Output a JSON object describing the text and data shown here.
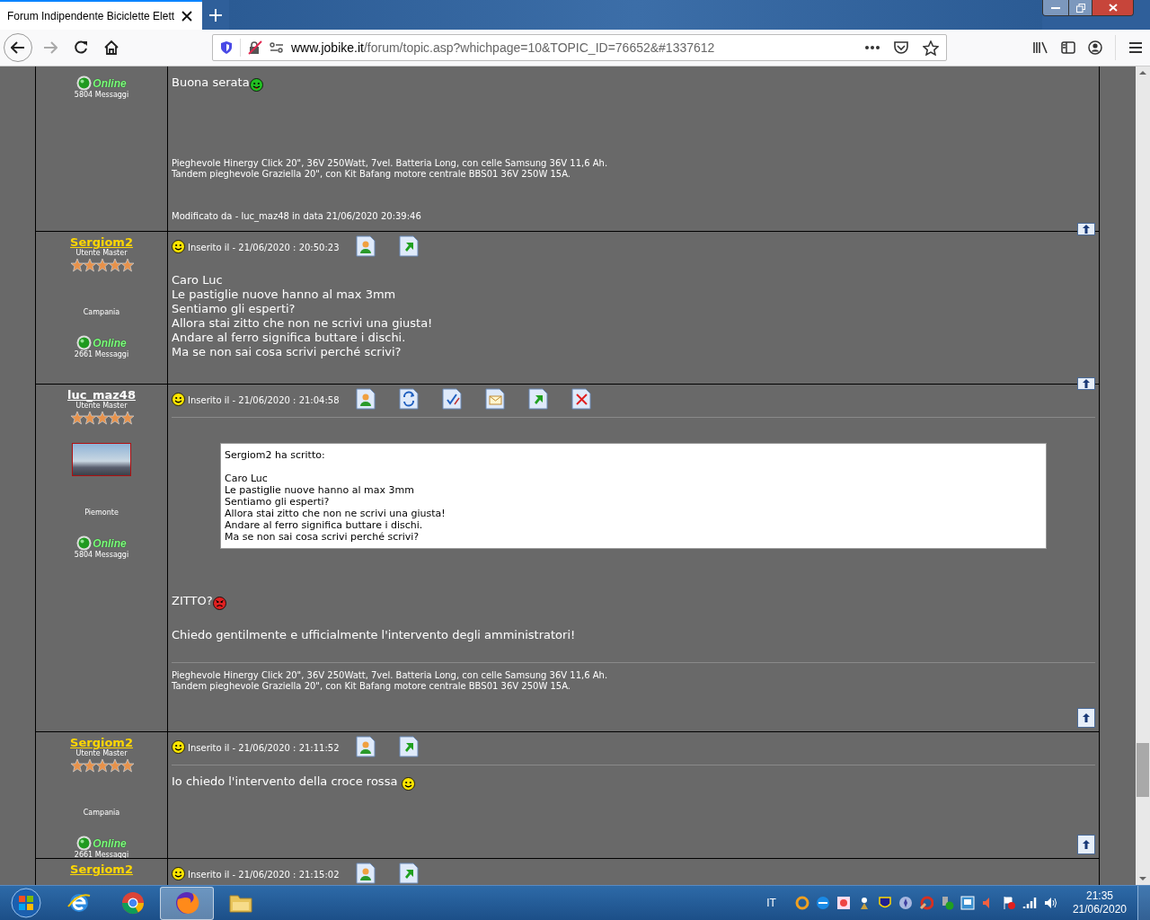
{
  "browser": {
    "tab_title": "Forum Indipendente Biciclette Elett",
    "url_host": "www.jobike.it",
    "url_path": "/forum/topic.asp?whichpage=10&TOPIC_ID=76652&#1337612"
  },
  "posts": [
    {
      "author": {
        "status": "Online",
        "post_count": "5804 Messaggi"
      },
      "body": [
        {
          "kind": "text",
          "lines": [
            "Buona serata"
          ],
          "emoticon": {
            "kind": "tongue"
          }
        }
      ],
      "signature": [
        "Pieghevole Hinergy Click 20\", 36V 250Watt, 7vel. Batteria Long, con celle Samsung 36V 11,6 Ah.",
        "Tandem pieghevole Graziella 20\", con Kit Bafang motore centrale BBS01 36V 250W 15A."
      ],
      "edited": "Modificato da - luc_maz48 in data 21/06/2020 20:39:46"
    },
    {
      "author": {
        "name": "Sergiom2",
        "color": "#ffd700",
        "rank": "Utente Master",
        "stars": 5,
        "region": "Campania",
        "status": "Online",
        "post_count": "2661 Messaggi"
      },
      "posted": "Inserito il - 21/06/2020 : 20:50:23",
      "actions": [
        {
          "kind": "profile"
        },
        {
          "kind": "quote"
        }
      ],
      "body": [
        {
          "kind": "text",
          "lines": [
            "Caro Luc",
            "Le pastiglie nuove hanno al max 3mm",
            "Sentiamo gli esperti?",
            "Allora stai zitto che non ne scrivi una giusta!",
            "Andare al ferro significa buttare i dischi.",
            "Ma se non sai cosa scrivi perché scrivi?"
          ]
        }
      ]
    },
    {
      "author": {
        "name": "luc_maz48",
        "color": "#ffffff",
        "rank": "Utente Master",
        "stars": 5,
        "avatar": true,
        "region": "Piemonte",
        "status": "Online",
        "post_count": "5804 Messaggi"
      },
      "posted": "Inserito il - 21/06/2020 : 21:04:58",
      "actions": [
        {
          "kind": "profile"
        },
        {
          "kind": "reply"
        },
        {
          "kind": "edit"
        },
        {
          "kind": "email"
        },
        {
          "kind": "quote"
        },
        {
          "kind": "delete"
        }
      ],
      "body": [
        {
          "kind": "quote",
          "header": "Sergiom2 ha scritto:",
          "lines": [
            "Caro Luc",
            "Le pastiglie nuove hanno al max 3mm",
            "Sentiamo gli esperti?",
            "Allora stai zitto che non ne scrivi una giusta!",
            "Andare al ferro significa buttare i dischi.",
            "Ma se non sai cosa scrivi perché scrivi?"
          ]
        },
        {
          "kind": "text",
          "lines": [
            "ZITTO?"
          ],
          "emoticon": {
            "kind": "angry"
          }
        },
        {
          "kind": "text",
          "lines": [
            "Chiedo gentilmente e ufficialmente l'intervento degli amministratori!"
          ]
        }
      ],
      "signature": [
        "Pieghevole Hinergy Click 20\", 36V 250Watt, 7vel. Batteria Long, con celle Samsung 36V 11,6 Ah.",
        "Tandem pieghevole Graziella 20\", con Kit Bafang motore centrale BBS01 36V 250W 15A."
      ]
    },
    {
      "author": {
        "name": "Sergiom2",
        "color": "#ffd700",
        "rank": "Utente Master",
        "stars": 5,
        "region": "Campania",
        "status": "Online",
        "post_count": "2661 Messaggi"
      },
      "posted": "Inserito il - 21/06/2020 : 21:11:52",
      "actions": [
        {
          "kind": "profile"
        },
        {
          "kind": "quote"
        }
      ],
      "body": [
        {
          "kind": "text",
          "lines": [
            "Io chiedo l'intervento della croce rossa "
          ],
          "emoticon": {
            "kind": "happy"
          }
        }
      ]
    },
    {
      "author": {
        "name": "Sergiom2",
        "color": "#ffd700"
      },
      "posted": "Inserito il - 21/06/2020 : 21:15:02",
      "actions": [
        {
          "kind": "profile"
        },
        {
          "kind": "quote"
        }
      ]
    }
  ],
  "taskbar": {
    "apps": [
      {
        "kind": "ie",
        "selected": false
      },
      {
        "kind": "chrome",
        "selected": false
      },
      {
        "kind": "firefox",
        "selected": true
      },
      {
        "kind": "explorer",
        "selected": false
      }
    ],
    "language": "IT",
    "time": "21:35",
    "date": "21/06/2020"
  }
}
